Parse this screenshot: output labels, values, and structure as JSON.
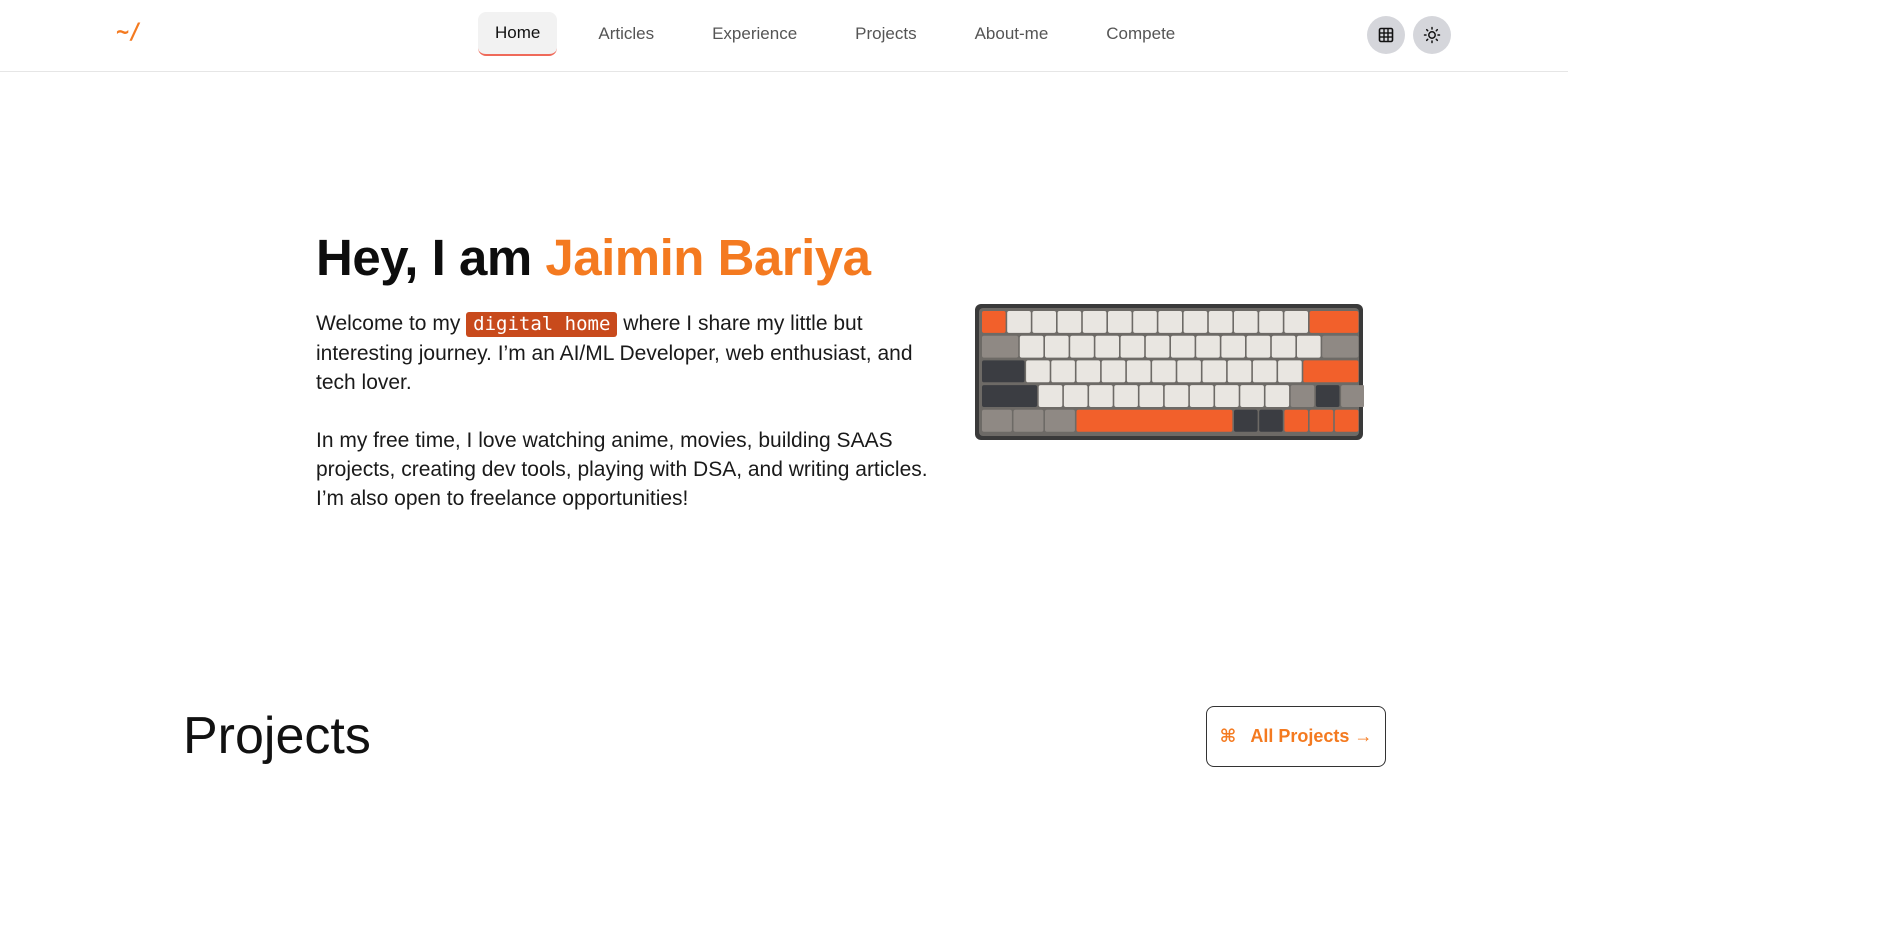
{
  "header": {
    "logo": "~/",
    "nav": [
      {
        "label": "Home",
        "active": true
      },
      {
        "label": "Articles"
      },
      {
        "label": "Experience"
      },
      {
        "label": "Projects"
      },
      {
        "label": "About-me"
      },
      {
        "label": "Compete"
      }
    ],
    "icons": [
      "grid-icon",
      "sun-icon"
    ]
  },
  "hero": {
    "title_prefix": "Hey, I am ",
    "title_name": "Jaimin Bariya",
    "p1_before": "Welcome to my ",
    "p1_highlight": "digital home",
    "p1_after": " where I share my little but interesting journey. I’m an AI/ML Developer, web enthusiast, and tech lover.",
    "p2": "In my free time, I love watching anime, movies, building SAAS projects, creating dev tools, playing with DSA, and writing articles. I’m also open to freelance opportunities!",
    "image": "mechanical-keyboard-image"
  },
  "projects": {
    "title": "Projects",
    "all_button_icon": "⌘",
    "all_button_label": "All Projects →"
  },
  "colors": {
    "accent": "#f47a20",
    "highlight_bg": "#c84a1c",
    "icon_button_bg": "#d5d6db"
  }
}
